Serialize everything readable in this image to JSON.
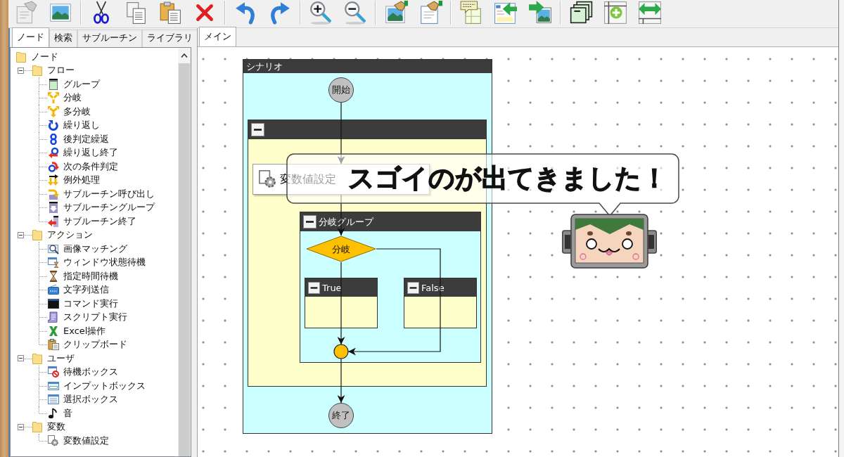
{
  "toolbar": {
    "groups": [
      {
        "buttons": [
          {
            "disabled": true
          },
          {
            "disabled": false
          }
        ]
      },
      {
        "buttons": [
          {
            "disabled": false
          },
          {
            "disabled": false
          },
          {
            "disabled": false
          },
          {
            "disabled": false
          }
        ]
      },
      {
        "buttons": [
          {
            "disabled": false
          },
          {
            "disabled": false
          }
        ]
      },
      {
        "buttons": [
          {
            "disabled": false
          },
          {
            "disabled": false
          }
        ]
      },
      {
        "buttons": [
          {
            "disabled": false
          },
          {
            "disabled": false
          }
        ]
      },
      {
        "buttons": [
          {
            "disabled": false
          },
          {
            "disabled": false
          },
          {
            "disabled": false
          }
        ]
      },
      {
        "buttons": [
          {
            "disabled": false
          },
          {
            "disabled": false
          },
          {
            "disabled": false
          }
        ]
      }
    ]
  },
  "left_panel": {
    "tabs": [
      {
        "label": "ノード",
        "selected": true
      },
      {
        "label": "検索",
        "selected": false
      },
      {
        "label": "サブルーチン",
        "selected": false
      },
      {
        "label": "ライブラリ",
        "selected": false
      }
    ],
    "tree": [
      {
        "label": "ノード",
        "children": [
          {
            "label": "フロー",
            "expanded": true,
            "children": [
              {
                "label": "グループ"
              },
              {
                "label": "分岐"
              },
              {
                "label": "多分岐"
              },
              {
                "label": "繰り返し"
              },
              {
                "label": "後判定繰返"
              },
              {
                "label": "繰り返し終了"
              },
              {
                "label": "次の条件判定"
              },
              {
                "label": "例外処理"
              },
              {
                "label": "サブルーチン呼び出し"
              },
              {
                "label": "サブルーチングループ"
              },
              {
                "label": "サブルーチン終了"
              }
            ]
          },
          {
            "label": "アクション",
            "expanded": true,
            "children": [
              {
                "label": "画像マッチング"
              },
              {
                "label": "ウィンドウ状態待機"
              },
              {
                "label": "指定時間待機"
              },
              {
                "label": "文字列送信"
              },
              {
                "label": "コマンド実行"
              },
              {
                "label": "スクリプト実行"
              },
              {
                "label": "Excel操作"
              },
              {
                "label": "クリップボード"
              }
            ]
          },
          {
            "label": "ユーザ",
            "expanded": true,
            "children": [
              {
                "label": "待機ボックス"
              },
              {
                "label": "インプットボックス"
              },
              {
                "label": "選択ボックス"
              },
              {
                "label": "音"
              }
            ]
          },
          {
            "label": "変数",
            "expanded": true,
            "children": [
              {
                "label": "変数値設定"
              }
            ]
          }
        ]
      }
    ]
  },
  "main": {
    "tabs": [
      {
        "label": "メイン",
        "selected": true
      }
    ],
    "diagram": {
      "title": "シナリオ",
      "start": {
        "label": "開始"
      },
      "group": {
        "expanded": true
      },
      "action": {
        "label": "変数値設定"
      },
      "branch_group": {
        "title": "分岐グループ",
        "expanded": true
      },
      "decision": {
        "label": "分岐"
      },
      "cases": [
        {
          "label": "True",
          "expanded": true
        },
        {
          "label": "False",
          "expanded": true
        }
      ],
      "end": {
        "label": "終了"
      }
    }
  },
  "callout": {
    "text": "スゴイのが出てきました！"
  }
}
